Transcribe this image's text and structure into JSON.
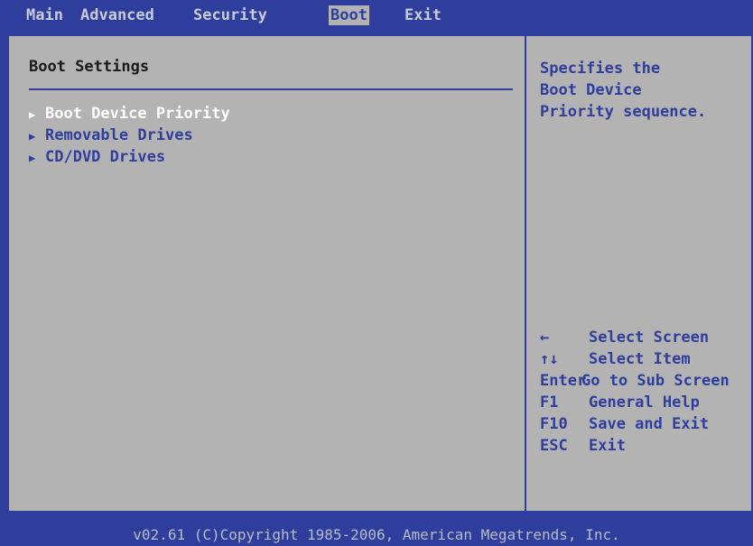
{
  "menu": {
    "tabs": [
      {
        "label": "Main"
      },
      {
        "label": "Advanced"
      },
      {
        "label": "Security"
      },
      {
        "label": "Boot"
      },
      {
        "label": "Exit"
      }
    ],
    "active_tab": "Boot"
  },
  "main": {
    "section_title": "Boot Settings",
    "items": [
      {
        "label": "Boot Device Priority",
        "selected": true,
        "icon": "triangle-right-icon"
      },
      {
        "label": "Removable Drives",
        "selected": false,
        "icon": "triangle-right-icon"
      },
      {
        "label": "CD/DVD Drives",
        "selected": false,
        "icon": "triangle-right-icon"
      }
    ]
  },
  "help": {
    "lines": [
      "Specifies the",
      "Boot Device",
      "Priority sequence."
    ]
  },
  "keys": [
    {
      "key": "←",
      "action": "Select Screen"
    },
    {
      "key": "↑↓",
      "action": "Select Item"
    },
    {
      "key": "Enter",
      "action": "Go to Sub Screen"
    },
    {
      "key": "F1",
      "action": "General Help"
    },
    {
      "key": "F10",
      "action": "Save and Exit"
    },
    {
      "key": "ESC",
      "action": "Exit"
    }
  ],
  "footer": {
    "text": "v02.61 (C)Copyright 1985-2006, American Megatrends, Inc."
  },
  "colors": {
    "background_blue": "#2f3e9c",
    "panel_gray": "#b3b3b3",
    "selected_text": "#ffffff"
  }
}
